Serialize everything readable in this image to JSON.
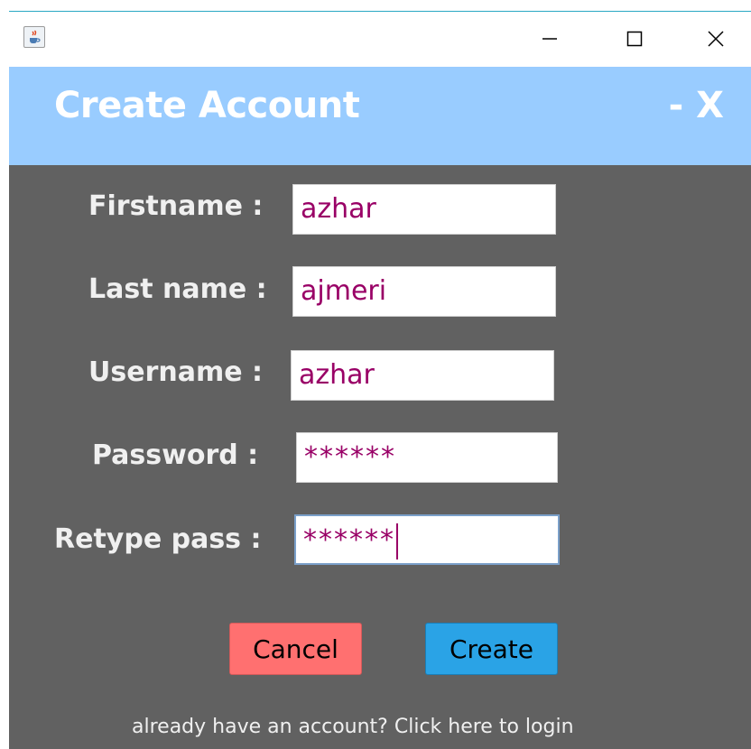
{
  "window": {
    "icon": "java-cup-icon",
    "controls": {
      "minimize": "minimize-icon",
      "maximize": "maximize-icon",
      "close": "close-icon"
    }
  },
  "header": {
    "title": "Create Account",
    "close_label": "- X",
    "background": "#99ccff"
  },
  "form": {
    "firstname": {
      "label": "Firstname :",
      "value": "azhar"
    },
    "lastname": {
      "label": "Last name :",
      "value": "ajmeri"
    },
    "username": {
      "label": "Username :",
      "value": "azhar"
    },
    "password": {
      "label": "Password :",
      "value": "******"
    },
    "retype": {
      "label": "Retype pass :",
      "value": "******"
    }
  },
  "buttons": {
    "cancel_label": "Cancel",
    "create_label": "Create",
    "cancel_color": "#ff7070",
    "create_color": "#2aa3e6"
  },
  "login_link": "already have an account? Click here to login"
}
